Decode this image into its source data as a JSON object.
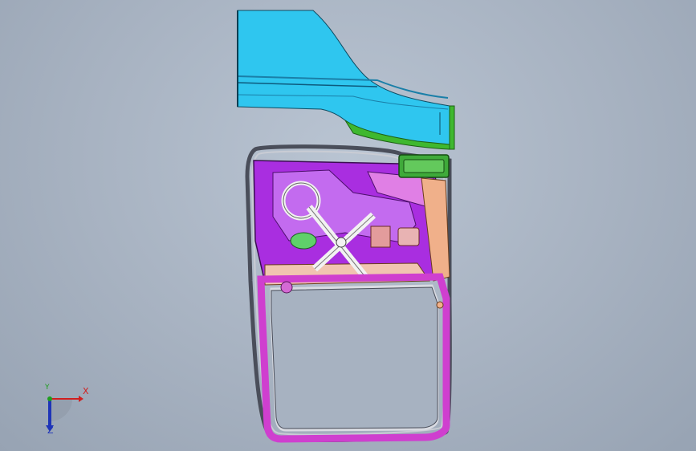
{
  "viewport": {
    "background": "#a7b2c1"
  },
  "model": {
    "parts": [
      {
        "name": "fender-panel",
        "color": "#2fc6ef"
      },
      {
        "name": "fender-trim",
        "color": "#3fb82f"
      },
      {
        "name": "door-seal-frame",
        "color": "#5b5f6b"
      },
      {
        "name": "inner-door-panel",
        "color": "#a92ee0"
      },
      {
        "name": "window-regulator",
        "color": "#f2f2f2"
      },
      {
        "name": "mirror-bracket",
        "color": "#3faa3a"
      },
      {
        "name": "window-frame",
        "color": "#cf3fcf"
      }
    ]
  },
  "triad": {
    "x_label": "X",
    "y_label": "Y",
    "z_label": "Z",
    "x_color": "#d11f1f",
    "y_color": "#1f9e1f",
    "z_color": "#1e34b8"
  }
}
